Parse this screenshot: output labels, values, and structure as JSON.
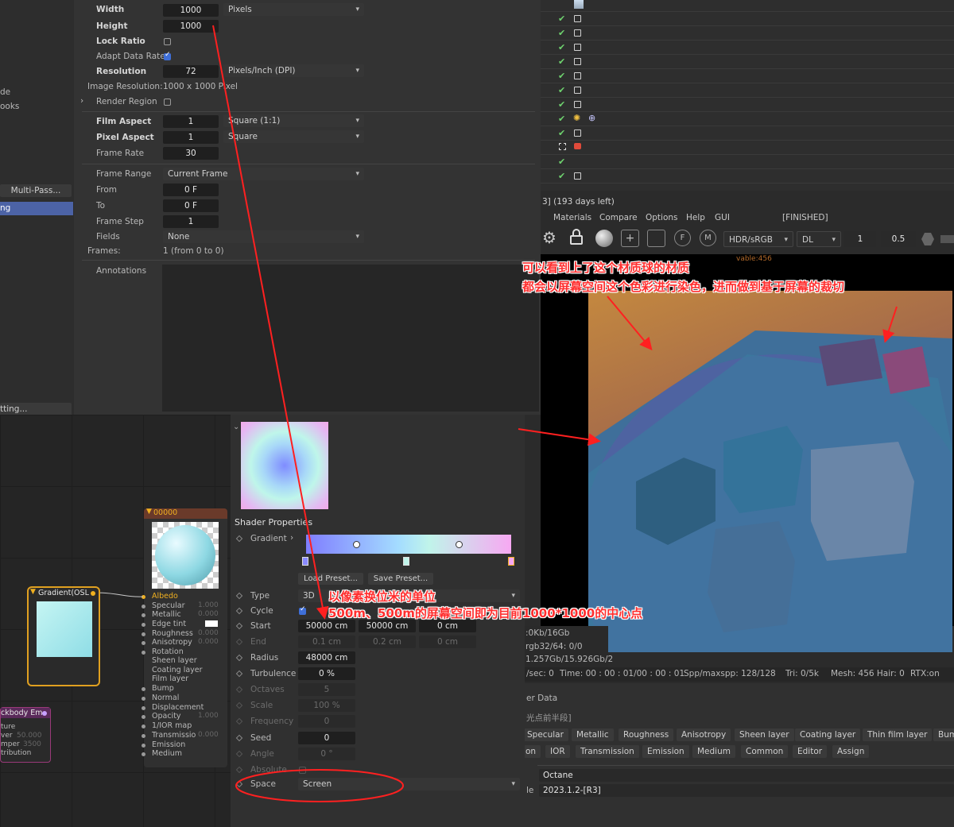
{
  "render_settings": {
    "width_label": "Width",
    "width_value": "1000",
    "width_unit": "Pixels",
    "height_label": "Height",
    "height_value": "1000",
    "lock_ratio_label": "Lock Ratio",
    "adapt_label": "Adapt Data Rate",
    "resolution_label": "Resolution",
    "resolution_value": "72",
    "resolution_unit": "Pixels/Inch (DPI)",
    "image_res_label": "Image Resolution:",
    "image_res_value": "1000 x 1000 Pixel",
    "render_region_label": "Render Region",
    "film_aspect_label": "Film Aspect",
    "film_aspect_value": "1",
    "film_aspect_unit": "Square (1:1)",
    "pixel_aspect_label": "Pixel Aspect",
    "pixel_aspect_value": "1",
    "pixel_aspect_unit": "Square",
    "frame_rate_label": "Frame Rate",
    "frame_rate_value": "30",
    "frame_range_label": "Frame Range",
    "frame_range_value": "Current Frame",
    "from_label": "From",
    "from_value": "0 F",
    "to_label": "To",
    "to_value": "0 F",
    "frame_step_label": "Frame Step",
    "frame_step_value": "1",
    "fields_label": "Fields",
    "fields_value": "None",
    "frames_label": "Frames:",
    "frames_value": "1 (from 0 to 0)",
    "annotations_label": "Annotations"
  },
  "left_sidebar": {
    "item_de": "de",
    "item_ooks": "ooks",
    "multipass": "Multi-Pass...",
    "active_item": "ng",
    "setting": "tting..."
  },
  "live_viewer": {
    "license": "3] (193 days left)",
    "menu": [
      "Materials",
      "Compare",
      "Options",
      "Help",
      "GUI"
    ],
    "status": "[FINISHED]",
    "color_space": "HDR/sRGB",
    "kernel": "DL",
    "val1": "1",
    "val2": "0.5",
    "mem1": ":0Kb/16Gb",
    "mem2": "rgb32/64: 0/0",
    "mem3": "1.257Gb/15.926Gb/2",
    "stats": {
      "rate": "/sec: 0",
      "time": "Time: 00 : 00 : 01/00 : 00 : 01",
      "spp": "Spp/maxspp: 128/128",
      "tri": "Tri: 0/5k",
      "mesh": "Mesh: 456  Hair: 0",
      "rtx": "RTX:on"
    },
    "partial_overlay": "vable:456"
  },
  "material_tabs_row1": [
    "Specular",
    "Metallic",
    "Roughness",
    "Anisotropy",
    "Sheen layer",
    "Coating layer",
    "Thin film layer",
    "Bum"
  ],
  "material_tabs_row2": [
    "on",
    "IOR",
    "Transmission",
    "Emission",
    "Medium",
    "Common",
    "Editor",
    "Assign"
  ],
  "material_info": {
    "user_data": "er Data",
    "cn_note": "光点前半段]",
    "type_label": "Octane",
    "version": "2023.1.2-[R3]",
    "version_prefix": "le"
  },
  "node_editor": {
    "material_node_title": "00000",
    "material_props": [
      "Albedo",
      "Specular",
      "Metallic",
      "Edge tint",
      "Roughness",
      "Anisotropy",
      "Rotation",
      "Sheen layer",
      "Coating layer",
      "Film layer",
      "Bump",
      "Normal",
      "Displacement",
      "Opacity",
      "1/IOR map",
      "Transmissio",
      "Emission",
      "Medium"
    ],
    "material_vals": [
      "",
      "1.000",
      "0.000",
      "",
      "0.000",
      "0.000",
      "",
      "",
      "",
      "",
      "",
      "",
      "",
      "1.000",
      "",
      "0.000",
      "",
      ""
    ],
    "gradient_node_title": "Gradient(OSL",
    "blackbody_title": "ckbody Em",
    "blackbody_props": [
      "ture",
      "ver",
      "mper",
      "tribution"
    ],
    "blackbody_vals": [
      "",
      "50.000",
      "3500",
      ""
    ]
  },
  "shader_props": {
    "title": "Shader Properties",
    "gradient_label": "Gradient",
    "load_preset": "Load Preset...",
    "save_preset": "Save Preset...",
    "type_label": "Type",
    "type_value": "3D",
    "cycle_label": "Cycle",
    "start_label": "Start",
    "start_x": "50000 cm",
    "start_y": "50000 cm",
    "start_z": "0 cm",
    "end_label": "End",
    "end_x": "0.1 cm",
    "end_y": "0.2 cm",
    "end_z": "0 cm",
    "radius_label": "Radius",
    "radius_value": "48000 cm",
    "turbulence_label": "Turbulence",
    "turbulence_value": "0 %",
    "octaves_label": "Octaves",
    "octaves_value": "5",
    "scale_label": "Scale",
    "scale_value": "100 %",
    "frequency_label": "Frequency",
    "frequency_value": "0",
    "seed_label": "Seed",
    "seed_value": "0",
    "angle_label": "Angle",
    "angle_value": "0 °",
    "absolute_label": "Absolute",
    "space_label": "Space",
    "space_value": "Screen"
  },
  "annotations": {
    "note1_line1": "可以看到上了这个材质球的材质",
    "note1_line2": "都会以屏幕空间这个色彩进行染色，进而做到基于屏幕的裁切",
    "note2_line1": "以像素换位米的单位",
    "note2_line2": "500m、500m的屏幕空间即为目前1000*1000的中心点"
  },
  "colors": {
    "annotation_red": "#ff2e2e",
    "check_green": "#6fd36f",
    "node_yellow": "#f0b020",
    "accent_blue": "#3f6fd8"
  }
}
